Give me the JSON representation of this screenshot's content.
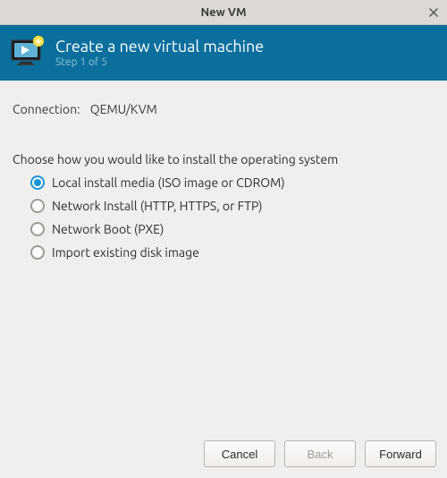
{
  "window": {
    "title": "New VM"
  },
  "banner": {
    "title": "Create a new virtual machine",
    "step": "Step 1 of 5"
  },
  "connection": {
    "label": "Connection:",
    "value": "QEMU/KVM"
  },
  "prompt": "Choose how you would like to install the operating system",
  "options": [
    {
      "label": "Local install media (ISO image or CDROM)",
      "selected": true
    },
    {
      "label": "Network Install (HTTP, HTTPS, or FTP)",
      "selected": false
    },
    {
      "label": "Network Boot (PXE)",
      "selected": false
    },
    {
      "label": "Import existing disk image",
      "selected": false
    }
  ],
  "footer": {
    "cancel": "Cancel",
    "back": "Back",
    "forward": "Forward"
  }
}
